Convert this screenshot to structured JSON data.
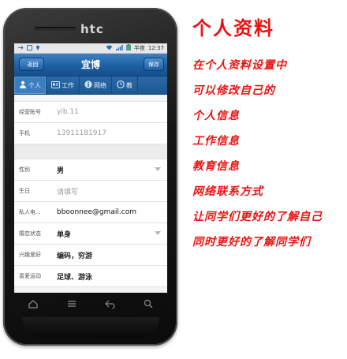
{
  "device": {
    "brand": "htc"
  },
  "statusbar": {
    "carrier": "半夜",
    "time": "12:37"
  },
  "titlebar": {
    "back_label": "返回",
    "title": "宜博",
    "save_label": "保存"
  },
  "tabs": [
    {
      "label": "个人",
      "icon": "person-icon",
      "active": true
    },
    {
      "label": "工作",
      "icon": "card-icon",
      "active": false
    },
    {
      "label": "网络",
      "icon": "info-icon",
      "active": false
    },
    {
      "label": "教",
      "icon": "clock-icon",
      "active": false
    }
  ],
  "fields_top": [
    {
      "label": "经营账号",
      "value": "yib.11"
    },
    {
      "label": "手机",
      "value": "13911181917"
    }
  ],
  "fields_main": [
    {
      "label": "性别",
      "value": "男"
    },
    {
      "label": "生日",
      "value": "请填写"
    },
    {
      "label": "私人电...",
      "value": "bboonnee@gmail.com"
    },
    {
      "label": "婚恋状态",
      "value": "单身"
    },
    {
      "label": "兴趣爱好",
      "value": "编码，穷游"
    },
    {
      "label": "喜爱运动",
      "value": "足球、游泳"
    }
  ],
  "notes": {
    "title": "个人资料",
    "lines": [
      "在个人资料设置中",
      "可以修改自己的",
      "个人信息",
      "工作信息",
      "教育信息",
      "网络联系方式",
      "让同学们更好的了解自己",
      "同时更好的了解同学们"
    ]
  },
  "colors": {
    "accent_blue": "#1e5fa1",
    "note_red": "#ee1111"
  }
}
